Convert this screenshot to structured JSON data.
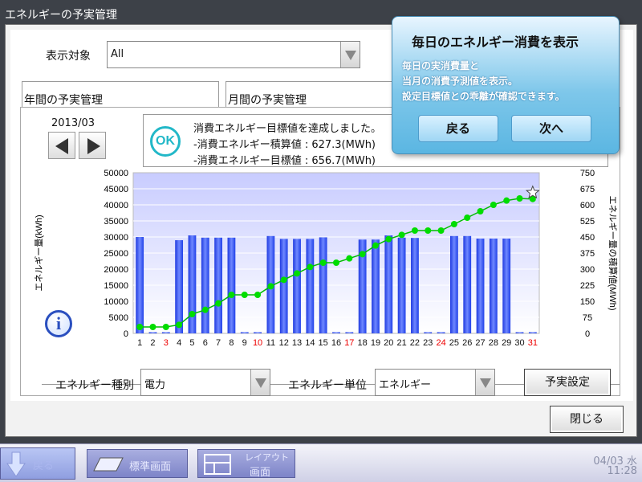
{
  "window": {
    "title": "エネルギーの予実管理"
  },
  "filter": {
    "label": "表示対象",
    "value": "All"
  },
  "tabs": [
    {
      "label": "年間の予実管理"
    },
    {
      "label": "月間の予実管理"
    }
  ],
  "nav": {
    "period": "2013/03"
  },
  "message": {
    "ok": "OK",
    "lines": [
      "消費エネルギー目標値を達成しました。",
      "-消費エネルギー積算値 : 627.3(MWh)",
      "-消費エネルギー目標値 : 656.7(MWh)"
    ]
  },
  "chart_data": {
    "type": "bar",
    "title": "",
    "ylabel": "エネルギー量(kWh)",
    "y2label": "エネルギー量の積算値(MWh)",
    "ylim": [
      0,
      50000
    ],
    "y2lim": [
      0,
      750
    ],
    "yticks": [
      "50000",
      "45000",
      "40000",
      "35000",
      "30000",
      "25000",
      "20000",
      "15000",
      "10000",
      "5000",
      "0"
    ],
    "y2ticks": [
      "750",
      "675",
      "600",
      "525",
      "450",
      "375",
      "300",
      "225",
      "150",
      "75",
      "0"
    ],
    "categories": [
      "1",
      "2",
      "3",
      "4",
      "5",
      "6",
      "7",
      "8",
      "9",
      "10",
      "11",
      "12",
      "13",
      "14",
      "15",
      "16",
      "17",
      "18",
      "19",
      "20",
      "21",
      "22",
      "23",
      "24",
      "25",
      "26",
      "27",
      "28",
      "29",
      "30",
      "31"
    ],
    "red_days": [
      3,
      10,
      17,
      24,
      31
    ],
    "series": [
      {
        "type": "bar",
        "values": [
          30000,
          0,
          0,
          29000,
          30500,
          29800,
          29800,
          29800,
          0,
          0,
          30300,
          29400,
          29400,
          29400,
          29900,
          0,
          0,
          29200,
          29200,
          30500,
          29800,
          29700,
          0,
          0,
          30300,
          30300,
          29500,
          29500,
          29500,
          0,
          0
        ]
      },
      {
        "type": "line",
        "axis": "right",
        "values": [
          30,
          30,
          30,
          40,
          90,
          110,
          140,
          180,
          180,
          180,
          220,
          250,
          280,
          310,
          330,
          330,
          350,
          370,
          410,
          440,
          460,
          480,
          480,
          480,
          510,
          540,
          570,
          600,
          620,
          630,
          627.3
        ]
      }
    ],
    "grid": true,
    "marker_last": "star-icon",
    "colors": {
      "bar": "#3b5cff",
      "line": "#00cc00",
      "plot_bg": "#dcdcff"
    }
  },
  "bottom": {
    "type_label": "エネルギー種別",
    "type_value": "電力",
    "unit_label": "エネルギー単位",
    "unit_value": "エネルギー",
    "budget_button": "予実設定",
    "close_button": "閉じる"
  },
  "taskbar": {
    "back": "戻る",
    "standard": "標準画面",
    "layout": "レイアウト",
    "layout2": "画面",
    "date": "04/03 水",
    "time": "11:28"
  },
  "popup": {
    "title": "毎日のエネルギー消費を表示",
    "body": [
      "毎日の実消費量と",
      "当月の消費予測値を表示。",
      "設定目標値との乖離が確認できます。"
    ],
    "back": "戻る",
    "next": "次へ"
  }
}
